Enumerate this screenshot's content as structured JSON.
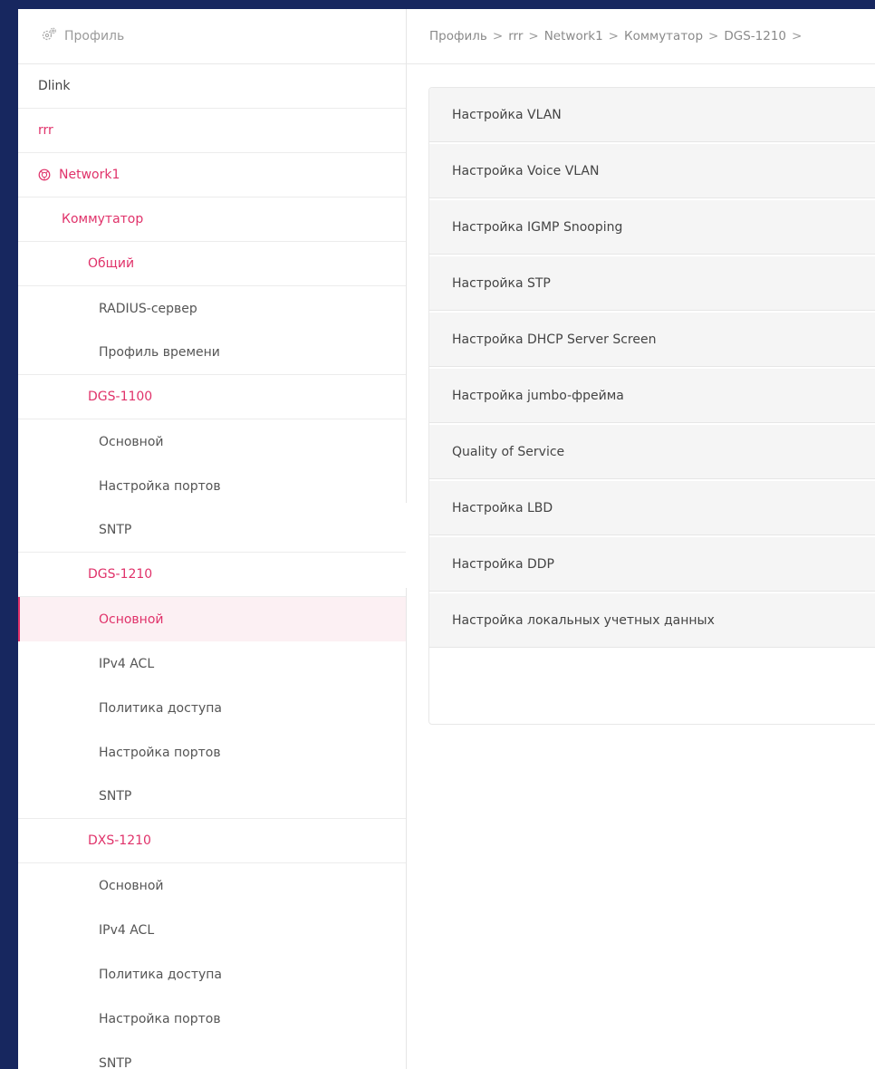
{
  "sidebar": {
    "header_label": "Профиль",
    "items": [
      {
        "label": "Dlink"
      },
      {
        "label": "rrr"
      },
      {
        "label": "Network1"
      },
      {
        "label": "Коммутатор"
      },
      {
        "label": "Общий"
      },
      {
        "label": "RADIUS-сервер"
      },
      {
        "label": "Профиль времени"
      },
      {
        "label": "DGS-1100"
      },
      {
        "label": "Основной"
      },
      {
        "label": "Настройка портов"
      },
      {
        "label": "SNTP"
      },
      {
        "label": "DGS-1210"
      },
      {
        "label": "Основной"
      },
      {
        "label": "IPv4 ACL"
      },
      {
        "label": "Политика доступа"
      },
      {
        "label": "Настройка портов"
      },
      {
        "label": "SNTP"
      },
      {
        "label": "DXS-1210"
      },
      {
        "label": "Основной"
      },
      {
        "label": "IPv4 ACL"
      },
      {
        "label": "Политика доступа"
      },
      {
        "label": "Настройка портов"
      },
      {
        "label": "SNTP"
      }
    ]
  },
  "breadcrumb": [
    "Профиль",
    "rrr",
    "Network1",
    "Коммутатор",
    "DGS-1210"
  ],
  "breadcrumb_separator": ">",
  "settings": [
    {
      "label": "Настройка VLAN"
    },
    {
      "label": "Настройка Voice VLAN"
    },
    {
      "label": "Настройка IGMP Snooping"
    },
    {
      "label": "Настройка STP"
    },
    {
      "label": "Настройка DHCP Server Screen"
    },
    {
      "label": "Настройка jumbo-фрейма"
    },
    {
      "label": "Quality of Service"
    },
    {
      "label": "Настройка LBD"
    },
    {
      "label": "Настройка DDP"
    },
    {
      "label": "Настройка локальных учетных данных"
    }
  ],
  "colors": {
    "accent": "#e0326a",
    "background": "#17275f",
    "row_background": "#f5f5f5"
  },
  "icons": {
    "header": "settings-gear-icon",
    "network": "network-globe-icon",
    "collapse": "chevron-left-icon"
  }
}
